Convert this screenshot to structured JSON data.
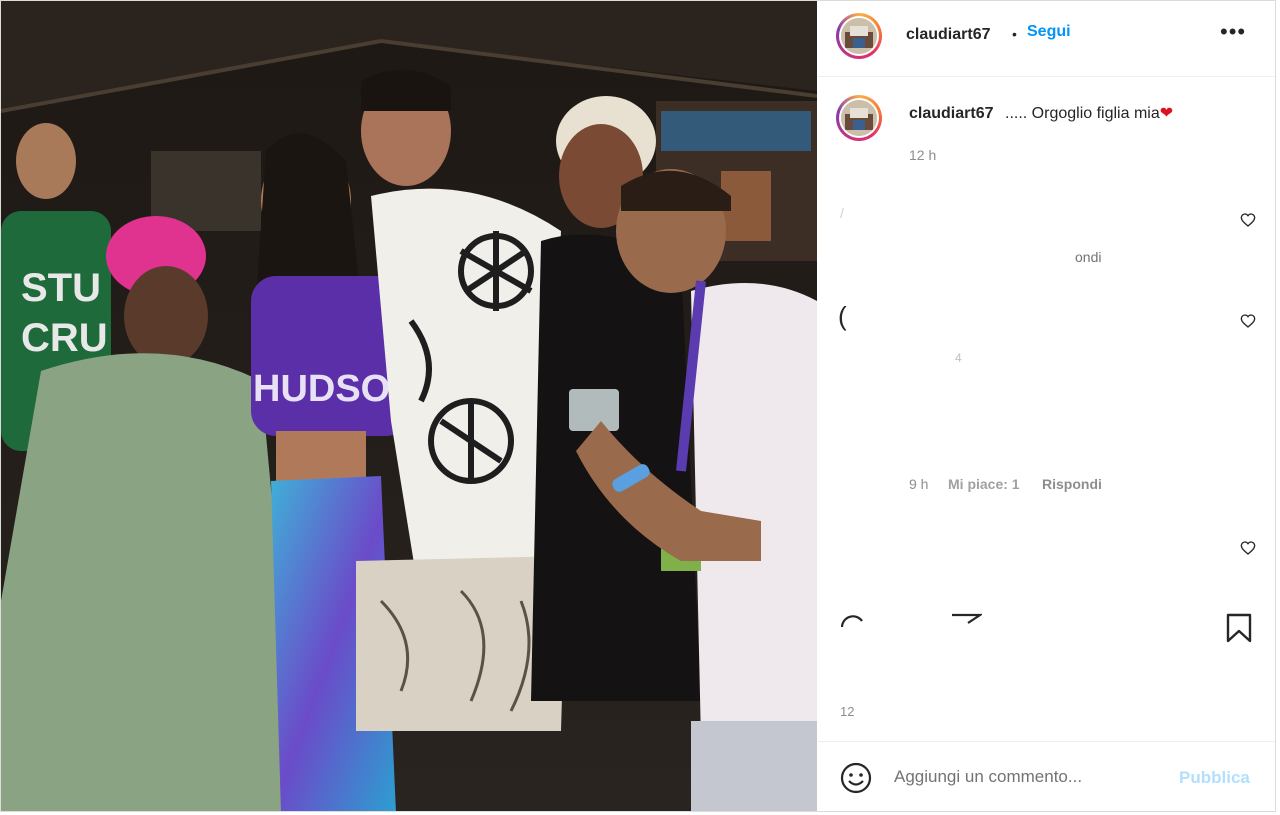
{
  "post": {
    "username": "claudiart67",
    "separator": "•",
    "follow_label": "Segui",
    "more_label": "•••"
  },
  "caption": {
    "username": "claudiart67",
    "text": "..... Orgoglio figlia mia",
    "emoji": "❤",
    "time": "12 h"
  },
  "comments": {
    "fragment1": "/",
    "fragment2": "ondi",
    "fragment3": "(",
    "fragment4": "4",
    "fragment5_time": "9 h",
    "fragment5_likes": "Mi piace: 1",
    "fragment5_reply": "Rispondi"
  },
  "likes_partial": "12",
  "add_comment": {
    "placeholder": "Aggiungi un commento...",
    "publish_label": "Pubblica"
  },
  "icons": [
    "heart-icon",
    "comment-icon",
    "share-icon",
    "bookmark-icon",
    "emoji-icon",
    "more-icon"
  ],
  "colors": {
    "accent": "#0095f6",
    "publish_disabled": "#b2dffc",
    "muted": "#8e8e8e"
  }
}
